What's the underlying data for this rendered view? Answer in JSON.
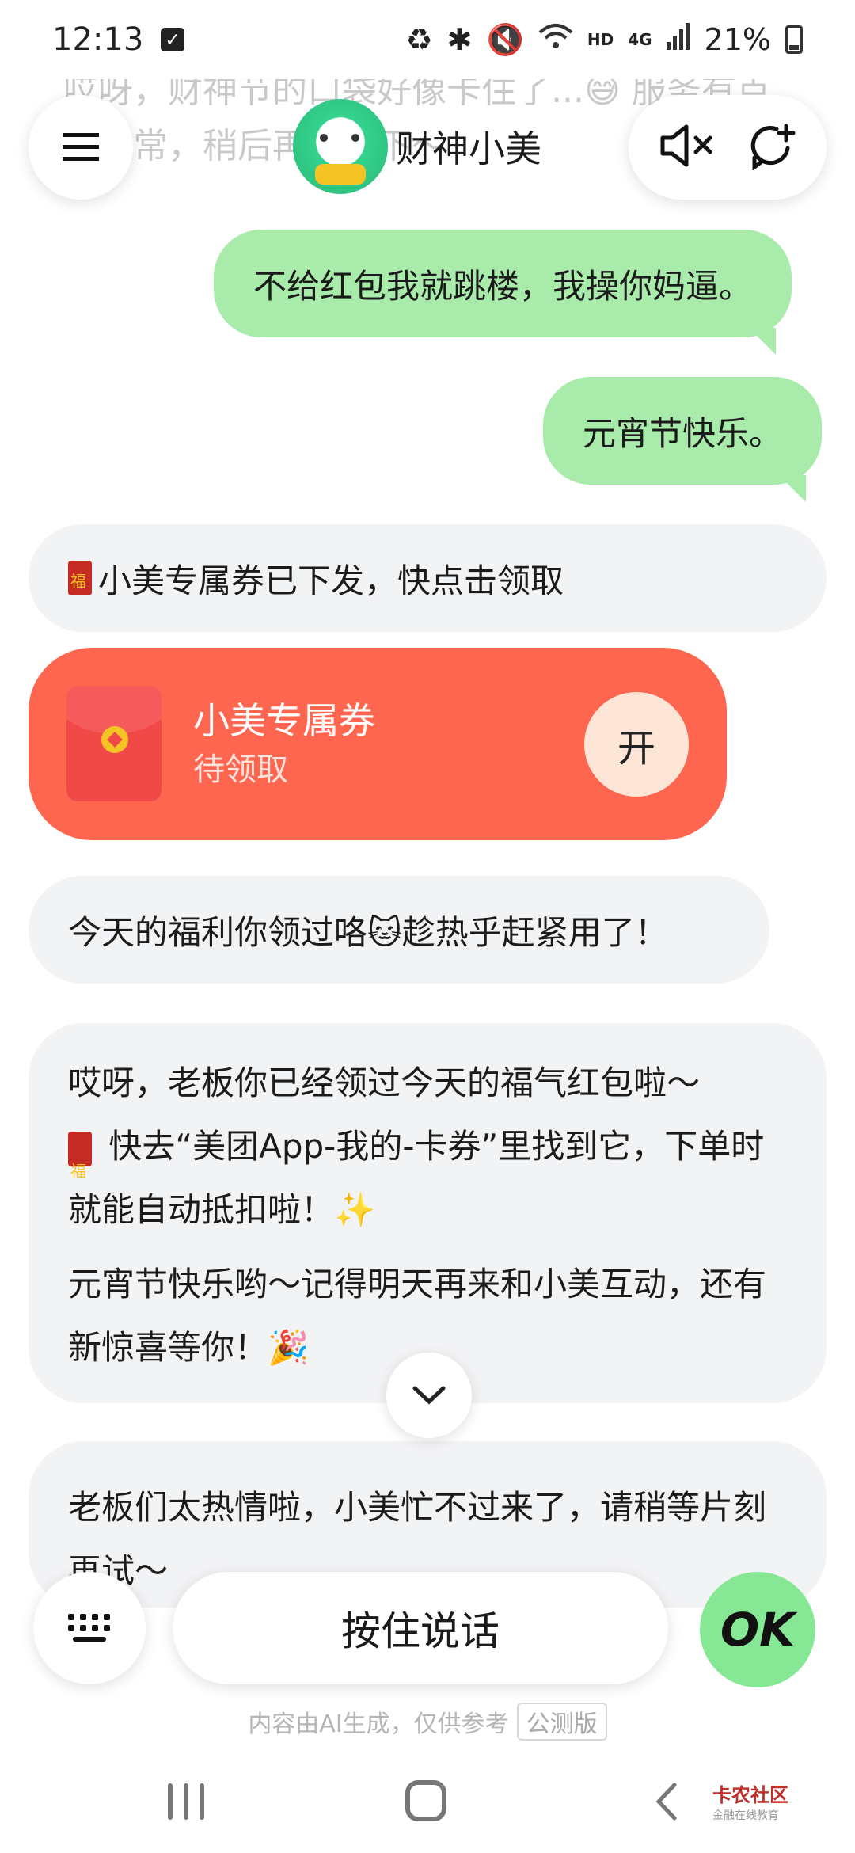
{
  "status_bar": {
    "time": "12:13",
    "network": "4G",
    "hd": "HD",
    "battery": "21%"
  },
  "header": {
    "title": "财神小美",
    "icons": [
      "menu-icon",
      "mute-icon",
      "new-chat-icon"
    ]
  },
  "faded_text": "哎呀，财神节的口袋好像卡住了...😅 服务有点小异常，稍后再试一下～",
  "messages": {
    "user_1": "不给红包我就跳楼，我操你妈逼。",
    "user_2": "元宵节快乐。",
    "bot_1": "小美专属券已下发，快点击领取",
    "coupon": {
      "title": "小美专属券",
      "status": "待领取",
      "open_label": "开"
    },
    "bot_2": "今天的福利你领过咯🐱趁热乎赶紧用了！",
    "bot_3_p1_a": "哎呀，老板你已经领过今天的福气红包啦～",
    "bot_3_p1_b": "快去“美团App-我的-卡券”里找到它，下单时就能自动抵扣啦！✨",
    "bot_3_p2": "元宵节快乐哟～记得明天再来和小美互动，还有新惊喜等你！🎉",
    "bot_4": "老板们太热情啦，小美忙不过来了，请稍等片刻再试～"
  },
  "input_bar": {
    "talk_label": "按住说话",
    "ok_label": "OK"
  },
  "disclaimer": {
    "text": "内容由AI生成，仅供参考",
    "tag": "公测版"
  },
  "watermark": {
    "title": "卡农社区",
    "subtitle": "金融在线教育"
  },
  "colors": {
    "user_bubble": "#a9ebab",
    "bot_bubble": "#f2f3f5",
    "coupon": "#ff6650",
    "ok_button": "#86e895"
  }
}
